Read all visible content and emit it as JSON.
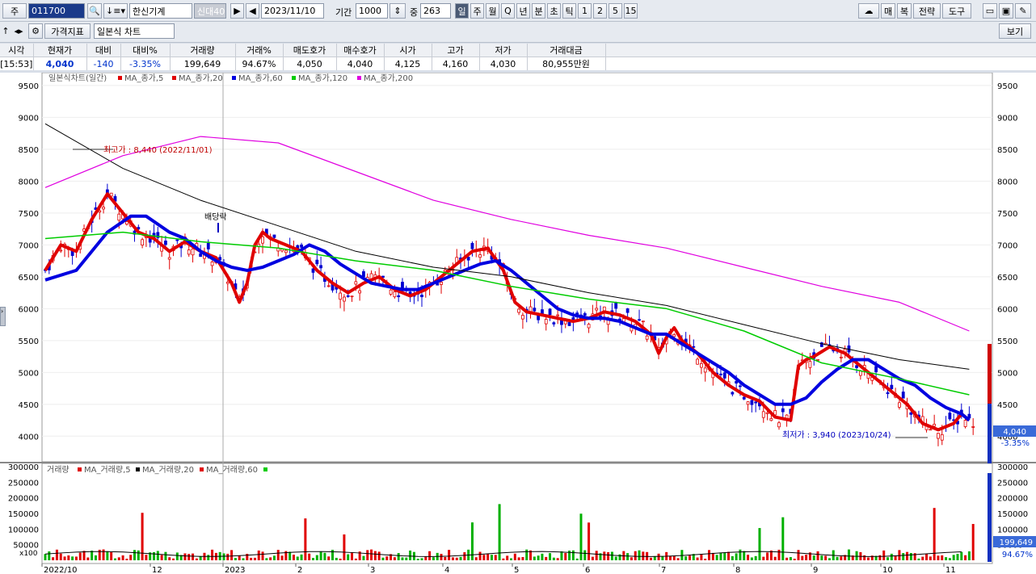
{
  "toolbar1": {
    "jong_label": "주",
    "code": "011700",
    "name": "한신기계",
    "tag": "신대40",
    "date": "2023/11/10",
    "period_label": "기간",
    "period": "1000",
    "jung_label": "중",
    "jung_value": "263",
    "periods": [
      "일",
      "주",
      "월",
      "Q",
      "년",
      "분",
      "초",
      "틱",
      "1",
      "2",
      "5",
      "15"
    ],
    "right_buttons": [
      "매",
      "복",
      "전략",
      "도구"
    ]
  },
  "toolbar2": {
    "indicator_label": "가격지표",
    "chart_type": "일본식 차트",
    "view_label": "보기"
  },
  "quote": {
    "headers": [
      "시각",
      "현재가",
      "대비",
      "대비%",
      "거래량",
      "거래%",
      "매도호가",
      "매수호가",
      "시가",
      "고가",
      "저가",
      "거래대금"
    ],
    "values": [
      "[15:53]",
      "4,040",
      "-140",
      "-3.35%",
      "199,649",
      "94.67%",
      "4,050",
      "4,040",
      "4,125",
      "4,160",
      "4,030",
      "80,955만원"
    ]
  },
  "legend_price": {
    "title": "일본식차트(일간)",
    "items": [
      {
        "label": "MA_종가,5",
        "color": "#e00000"
      },
      {
        "label": "MA_종가,20",
        "color": "#e00000"
      },
      {
        "label": "MA_종가,60",
        "color": "#0000e0"
      },
      {
        "label": "MA_종가,120",
        "color": "#00cc00"
      },
      {
        "label": "MA_종가,200",
        "color": "#e000e0"
      }
    ]
  },
  "legend_volume": {
    "title": "거래량",
    "items": [
      {
        "label": "MA_거래량,5",
        "color": "#e00000"
      },
      {
        "label": "MA_거래량,20",
        "color": "#000000"
      },
      {
        "label": "MA_거래량,60",
        "color": "#e00000"
      }
    ],
    "last_color": "#00cc00"
  },
  "annotations": {
    "high": "최고가 : 8,440 (2022/11/01)",
    "low": "최저가 : 3,940 (2023/10/24)",
    "dividend": "배당락"
  },
  "price_axis": [
    "9500",
    "9000",
    "8500",
    "8000",
    "7500",
    "7000",
    "6500",
    "6000",
    "5500",
    "5000",
    "4500",
    "4000"
  ],
  "volume_axis": [
    "300000",
    "250000",
    "200000",
    "150000",
    "100000",
    "50000"
  ],
  "volume_unit": "x100",
  "current_price": "4,040",
  "current_change": "-3.35%",
  "current_volume": "199,649",
  "current_volume_pct": "94.67%",
  "x_labels": [
    "2022/10",
    "12",
    "2023",
    "2",
    "3",
    "4",
    "5",
    "6",
    "7",
    "8",
    "9",
    "10",
    "11"
  ],
  "chart_data": {
    "type": "candlestick",
    "title": "일본식차트(일간)",
    "ylim": [
      3700,
      9600
    ],
    "price_series": [
      {
        "name": "MA_종가,5",
        "color": "#e00000",
        "points": [
          [
            0,
            6600
          ],
          [
            4,
            7000
          ],
          [
            8,
            6900
          ],
          [
            12,
            7400
          ],
          [
            16,
            7800
          ],
          [
            20,
            7500
          ],
          [
            24,
            7200
          ],
          [
            28,
            7100
          ],
          [
            32,
            6900
          ],
          [
            36,
            7050
          ],
          [
            40,
            6900
          ],
          [
            44,
            6800
          ],
          [
            48,
            6400
          ],
          [
            50,
            6100
          ],
          [
            52,
            6400
          ],
          [
            54,
            7000
          ],
          [
            56,
            7200
          ],
          [
            58,
            7100
          ],
          [
            62,
            7000
          ],
          [
            66,
            6900
          ],
          [
            70,
            6600
          ],
          [
            74,
            6400
          ],
          [
            78,
            6250
          ],
          [
            82,
            6400
          ],
          [
            86,
            6500
          ],
          [
            90,
            6300
          ],
          [
            94,
            6200
          ],
          [
            98,
            6300
          ],
          [
            102,
            6500
          ],
          [
            106,
            6700
          ],
          [
            110,
            6900
          ],
          [
            114,
            6950
          ],
          [
            118,
            6600
          ],
          [
            121,
            6100
          ],
          [
            124,
            5950
          ],
          [
            128,
            5900
          ],
          [
            132,
            5850
          ],
          [
            136,
            5800
          ],
          [
            140,
            5850
          ],
          [
            144,
            5950
          ],
          [
            148,
            5900
          ],
          [
            152,
            5800
          ],
          [
            156,
            5600
          ],
          [
            158,
            5300
          ],
          [
            160,
            5550
          ],
          [
            162,
            5700
          ],
          [
            164,
            5500
          ],
          [
            168,
            5300
          ],
          [
            172,
            5000
          ],
          [
            176,
            4800
          ],
          [
            180,
            4650
          ],
          [
            184,
            4550
          ],
          [
            188,
            4300
          ],
          [
            192,
            4250
          ],
          [
            194,
            5100
          ],
          [
            196,
            5200
          ],
          [
            198,
            5250
          ],
          [
            202,
            5400
          ],
          [
            206,
            5300
          ],
          [
            210,
            5100
          ],
          [
            214,
            4900
          ],
          [
            218,
            4700
          ],
          [
            222,
            4500
          ],
          [
            226,
            4200
          ],
          [
            230,
            4100
          ],
          [
            234,
            4200
          ],
          [
            236,
            4350
          ],
          [
            238,
            4250
          ]
        ]
      },
      {
        "name": "MA_종가,60",
        "color": "#0000e0",
        "points": [
          [
            0,
            6450
          ],
          [
            8,
            6600
          ],
          [
            16,
            7200
          ],
          [
            22,
            7450
          ],
          [
            26,
            7450
          ],
          [
            32,
            7200
          ],
          [
            36,
            7100
          ],
          [
            40,
            6900
          ],
          [
            44,
            6750
          ],
          [
            48,
            6650
          ],
          [
            52,
            6600
          ],
          [
            56,
            6650
          ],
          [
            60,
            6750
          ],
          [
            64,
            6850
          ],
          [
            68,
            7000
          ],
          [
            72,
            6900
          ],
          [
            76,
            6700
          ],
          [
            80,
            6550
          ],
          [
            84,
            6400
          ],
          [
            88,
            6350
          ],
          [
            92,
            6300
          ],
          [
            96,
            6300
          ],
          [
            100,
            6400
          ],
          [
            104,
            6500
          ],
          [
            108,
            6600
          ],
          [
            112,
            6700
          ],
          [
            116,
            6750
          ],
          [
            120,
            6600
          ],
          [
            124,
            6400
          ],
          [
            128,
            6200
          ],
          [
            132,
            6000
          ],
          [
            136,
            5900
          ],
          [
            140,
            5850
          ],
          [
            144,
            5850
          ],
          [
            148,
            5800
          ],
          [
            152,
            5700
          ],
          [
            156,
            5600
          ],
          [
            160,
            5600
          ],
          [
            164,
            5450
          ],
          [
            168,
            5300
          ],
          [
            172,
            5150
          ],
          [
            176,
            5000
          ],
          [
            180,
            4800
          ],
          [
            184,
            4650
          ],
          [
            188,
            4500
          ],
          [
            192,
            4500
          ],
          [
            196,
            4600
          ],
          [
            200,
            4850
          ],
          [
            204,
            5050
          ],
          [
            208,
            5200
          ],
          [
            212,
            5200
          ],
          [
            216,
            5050
          ],
          [
            220,
            4900
          ],
          [
            224,
            4800
          ],
          [
            228,
            4600
          ],
          [
            232,
            4450
          ],
          [
            236,
            4350
          ],
          [
            238,
            4250
          ]
        ]
      },
      {
        "name": "MA_종가,120",
        "color": "#00cc00",
        "points": [
          [
            0,
            7100
          ],
          [
            20,
            7200
          ],
          [
            40,
            7050
          ],
          [
            60,
            6950
          ],
          [
            80,
            6750
          ],
          [
            100,
            6600
          ],
          [
            120,
            6350
          ],
          [
            140,
            6150
          ],
          [
            160,
            6000
          ],
          [
            180,
            5650
          ],
          [
            200,
            5150
          ],
          [
            220,
            4900
          ],
          [
            238,
            4650
          ]
        ]
      },
      {
        "name": "MA_종가,200",
        "color": "#000000",
        "points": [
          [
            0,
            8900
          ],
          [
            20,
            8200
          ],
          [
            40,
            7700
          ],
          [
            60,
            7300
          ],
          [
            80,
            6900
          ],
          [
            100,
            6650
          ],
          [
            120,
            6500
          ],
          [
            140,
            6250
          ],
          [
            160,
            6050
          ],
          [
            180,
            5750
          ],
          [
            200,
            5450
          ],
          [
            220,
            5200
          ],
          [
            238,
            5050
          ]
        ]
      },
      {
        "name": "MA_종가,200b",
        "color": "#e000e0",
        "points": [
          [
            0,
            7900
          ],
          [
            20,
            8400
          ],
          [
            40,
            8700
          ],
          [
            60,
            8600
          ],
          [
            80,
            8150
          ],
          [
            100,
            7700
          ],
          [
            120,
            7400
          ],
          [
            140,
            7150
          ],
          [
            160,
            6950
          ],
          [
            180,
            6650
          ],
          [
            200,
            6350
          ],
          [
            220,
            6100
          ],
          [
            238,
            5650
          ]
        ]
      }
    ],
    "n_bars": 240
  }
}
